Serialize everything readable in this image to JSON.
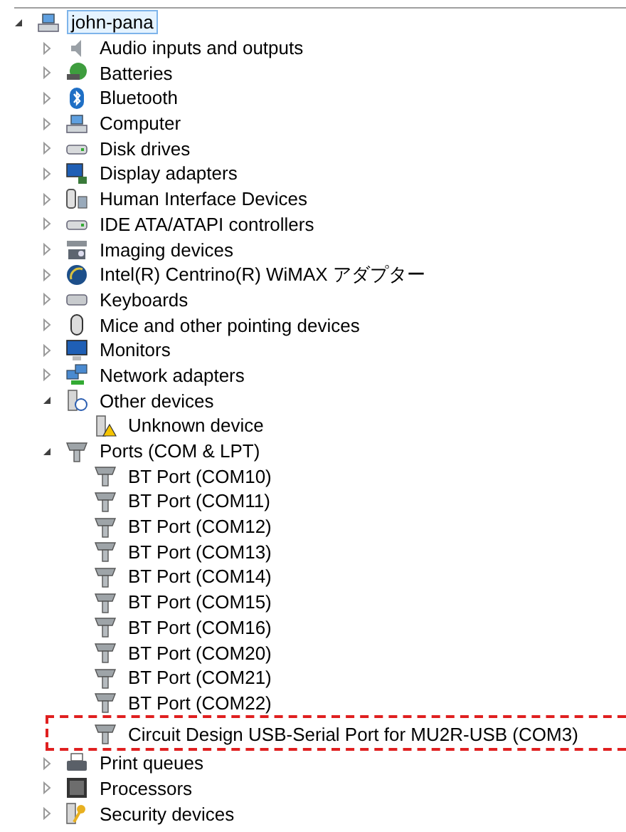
{
  "tree": [
    {
      "label": "john-pana",
      "kind": "computer",
      "expanded": true,
      "selected": true,
      "children": [
        {
          "label": "Audio inputs and outputs",
          "kind": "speaker",
          "expanded": false,
          "selected": false
        },
        {
          "label": "Batteries",
          "kind": "battery",
          "expanded": false,
          "selected": false
        },
        {
          "label": "Bluetooth",
          "kind": "bluetooth",
          "expanded": false,
          "selected": false
        },
        {
          "label": "Computer",
          "kind": "computer",
          "expanded": false,
          "selected": false
        },
        {
          "label": "Disk drives",
          "kind": "disk",
          "expanded": false,
          "selected": false
        },
        {
          "label": "Display adapters",
          "kind": "display",
          "expanded": false,
          "selected": false
        },
        {
          "label": "Human Interface Devices",
          "kind": "hid",
          "expanded": false,
          "selected": false
        },
        {
          "label": "IDE ATA/ATAPI controllers",
          "kind": "disk",
          "expanded": false,
          "selected": false
        },
        {
          "label": "Imaging devices",
          "kind": "camera",
          "expanded": false,
          "selected": false
        },
        {
          "label": "Intel(R) Centrino(R) WiMAX アダプター",
          "kind": "wireless",
          "expanded": false,
          "selected": false
        },
        {
          "label": "Keyboards",
          "kind": "keyboard",
          "expanded": false,
          "selected": false
        },
        {
          "label": "Mice and other pointing devices",
          "kind": "mouse",
          "expanded": false,
          "selected": false
        },
        {
          "label": "Monitors",
          "kind": "monitor",
          "expanded": false,
          "selected": false
        },
        {
          "label": "Network adapters",
          "kind": "network",
          "expanded": false,
          "selected": false
        },
        {
          "label": "Other devices",
          "kind": "unknown",
          "expanded": true,
          "selected": false,
          "children": [
            {
              "label": "Unknown device",
              "kind": "warning",
              "selected": false
            }
          ]
        },
        {
          "label": "Ports (COM & LPT)",
          "kind": "port",
          "expanded": true,
          "selected": false,
          "children": [
            {
              "label": "BT Port (COM10)",
              "kind": "port",
              "selected": false
            },
            {
              "label": "BT Port (COM11)",
              "kind": "port",
              "selected": false
            },
            {
              "label": "BT Port (COM12)",
              "kind": "port",
              "selected": false
            },
            {
              "label": "BT Port (COM13)",
              "kind": "port",
              "selected": false
            },
            {
              "label": "BT Port (COM14)",
              "kind": "port",
              "selected": false
            },
            {
              "label": "BT Port (COM15)",
              "kind": "port",
              "selected": false
            },
            {
              "label": "BT Port (COM16)",
              "kind": "port",
              "selected": false
            },
            {
              "label": "BT Port (COM20)",
              "kind": "port",
              "selected": false
            },
            {
              "label": "BT Port (COM21)",
              "kind": "port",
              "selected": false
            },
            {
              "label": "BT Port (COM22)",
              "kind": "port",
              "selected": false
            },
            {
              "label": "Circuit Design USB-Serial Port for MU2R-USB (COM3)",
              "kind": "port",
              "selected": false,
              "highlighted": true
            }
          ]
        },
        {
          "label": "Print queues",
          "kind": "printer",
          "expanded": false,
          "selected": false
        },
        {
          "label": "Processors",
          "kind": "processor",
          "expanded": false,
          "selected": false
        },
        {
          "label": "Security devices",
          "kind": "security",
          "expanded": false,
          "selected": false
        }
      ]
    }
  ]
}
